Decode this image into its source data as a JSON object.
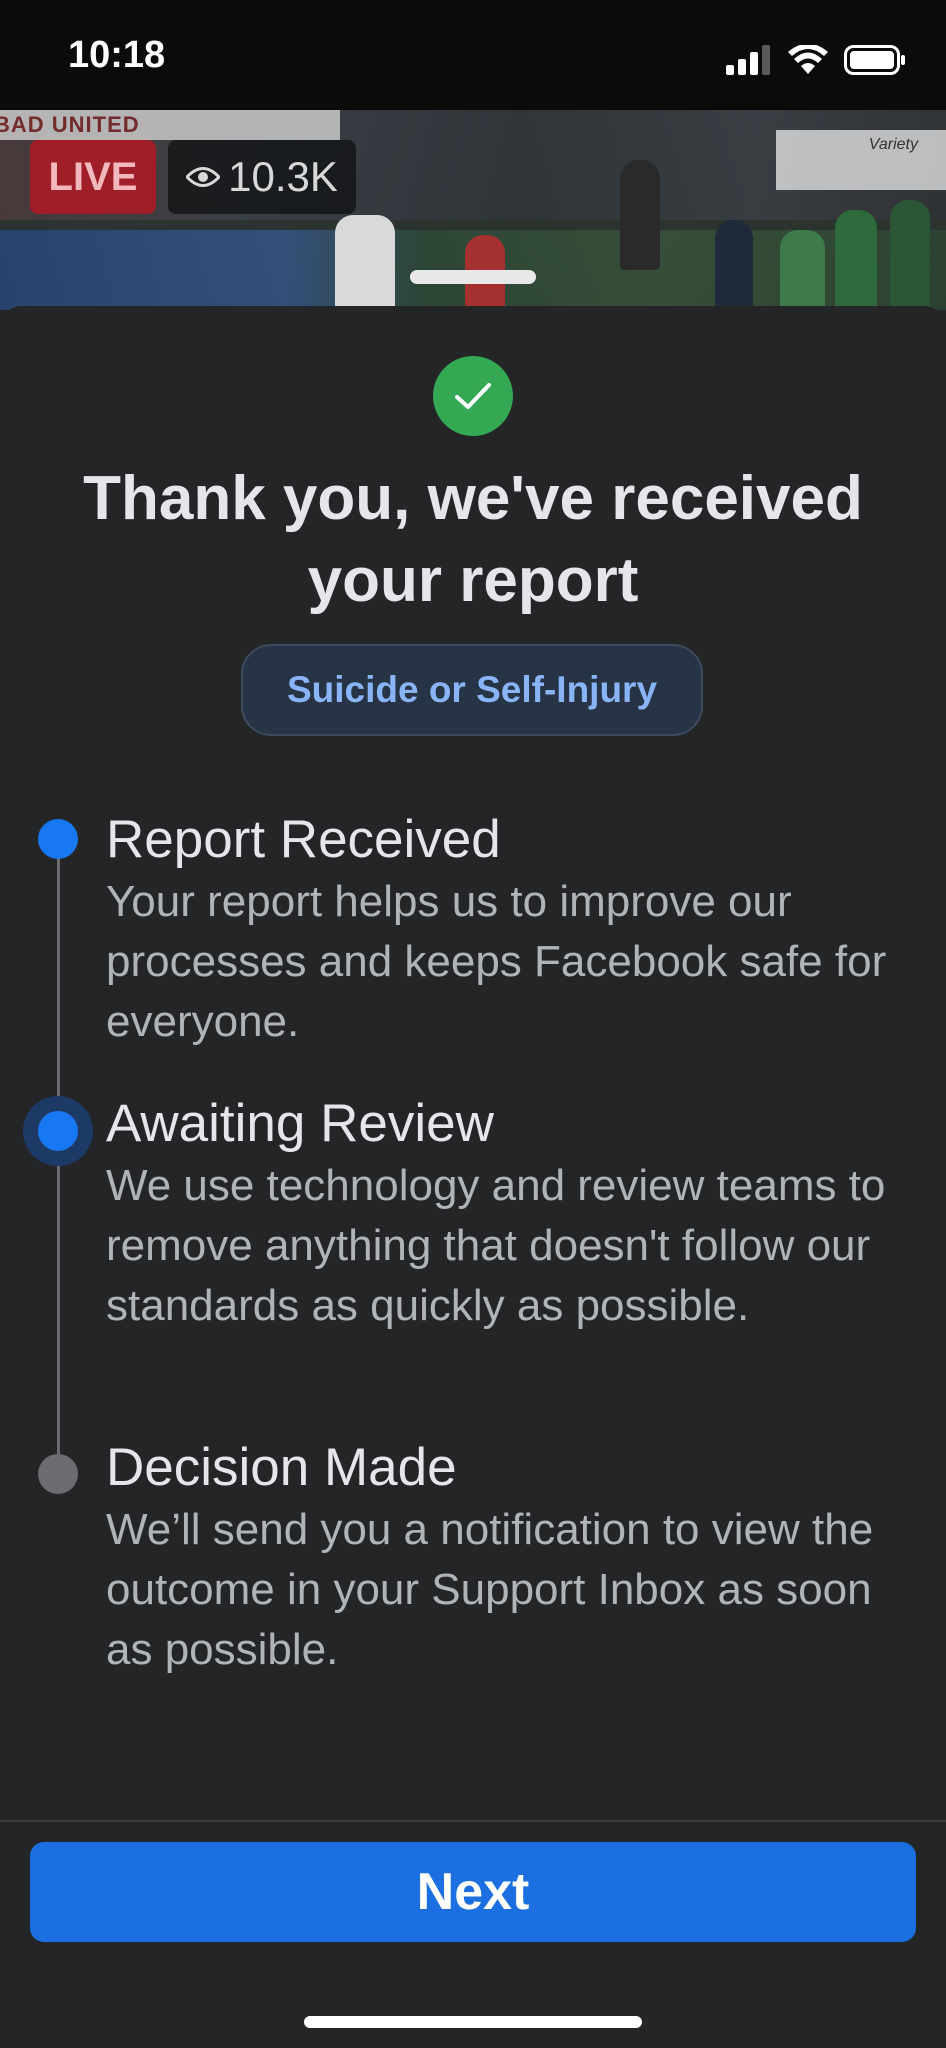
{
  "status_bar": {
    "time": "10:18"
  },
  "video": {
    "live_label": "LIVE",
    "viewer_count": "10.3K",
    "banner_text": "BAD UNITED",
    "ad_text": "Variety"
  },
  "report": {
    "title": "Thank you, we've received your report",
    "category": "Suicide or Self-Injury",
    "steps": [
      {
        "title": "Report Received",
        "body": "Your report helps us to improve our processes and keeps Facebook safe for everyone."
      },
      {
        "title": "Awaiting Review",
        "body": "We use technology and review teams to remove anything that doesn't follow our standards as quickly as possible."
      },
      {
        "title": "Decision Made",
        "body": "We’ll send you a notification to view the outcome in your Support Inbox as soon as possible."
      }
    ]
  },
  "footer": {
    "next_label": "Next"
  },
  "colors": {
    "accent": "#1b6fe0",
    "success": "#34a853",
    "step_active": "#1877f2",
    "step_pending": "#6a6c70",
    "live": "#a01e28"
  }
}
